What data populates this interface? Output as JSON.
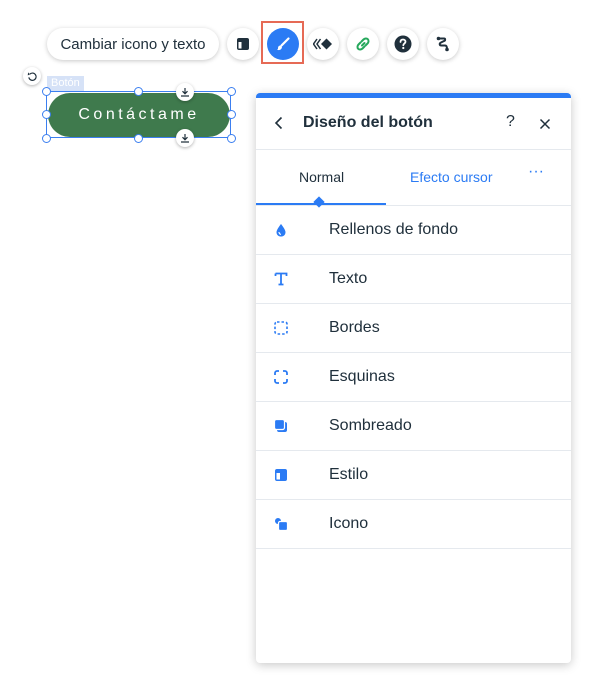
{
  "toolbar": {
    "change_icon_text_label": "Cambiar icono y texto",
    "buttons": [
      {
        "name": "layout-icon"
      },
      {
        "name": "design-brush-icon",
        "active": true
      },
      {
        "name": "animation-icon"
      },
      {
        "name": "link-icon"
      },
      {
        "name": "help-icon"
      },
      {
        "name": "connect-icon"
      }
    ],
    "colors": {
      "accent": "#2b7bf4",
      "highlight": "#e66a55",
      "link_green": "#26a85c"
    }
  },
  "canvas": {
    "element_label": "Botón",
    "button_text": "Contáctame",
    "button_color": "#3f7a4d"
  },
  "panel": {
    "title": "Diseño del botón",
    "help": "?",
    "tabs": {
      "normal": "Normal",
      "hover": "Efecto cursor",
      "more": "···"
    },
    "items": [
      {
        "label": "Rellenos de fondo",
        "icon": "drop-icon"
      },
      {
        "label": "Texto",
        "icon": "text-icon"
      },
      {
        "label": "Bordes",
        "icon": "borders-icon"
      },
      {
        "label": "Esquinas",
        "icon": "corners-icon"
      },
      {
        "label": "Sombreado",
        "icon": "shadow-icon"
      },
      {
        "label": "Estilo",
        "icon": "style-icon"
      },
      {
        "label": "Icono",
        "icon": "shapes-icon"
      }
    ]
  }
}
